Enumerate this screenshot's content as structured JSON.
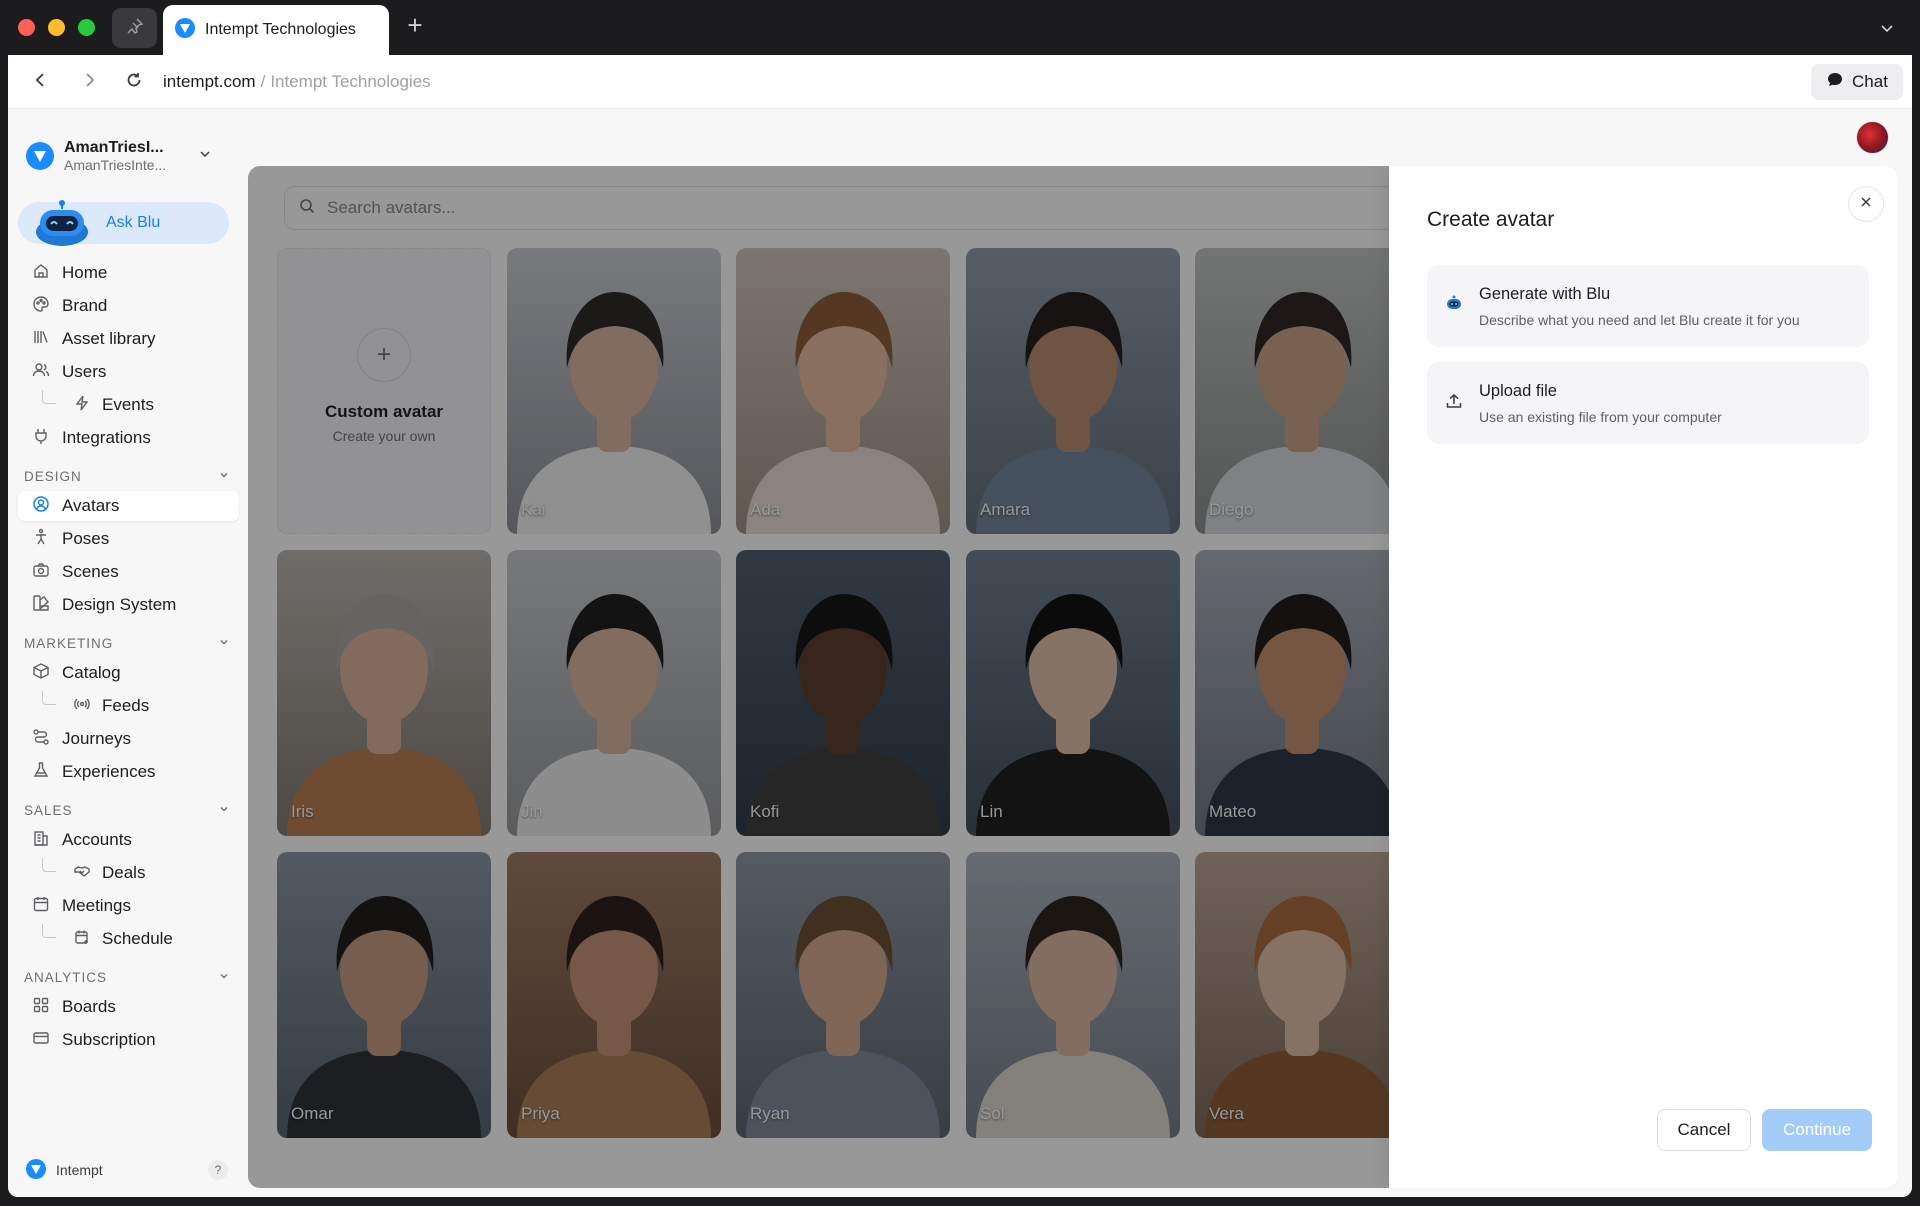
{
  "browser": {
    "tab_title": "Intempt Technologies",
    "url_domain": "intempt.com",
    "url_separator": "/",
    "url_title": "Intempt Technologies",
    "chat_label": "Chat"
  },
  "workspace": {
    "name": "AmanTriesI...",
    "subtitle": "AmanTriesInte..."
  },
  "ask_blu": "Ask Blu",
  "nav": {
    "home": "Home",
    "brand": "Brand",
    "asset_library": "Asset library",
    "users": "Users",
    "events": "Events",
    "integrations": "Integrations",
    "design_heading": "DESIGN",
    "avatars": "Avatars",
    "poses": "Poses",
    "scenes": "Scenes",
    "design_system": "Design System",
    "marketing_heading": "MARKETING",
    "catalog": "Catalog",
    "feeds": "Feeds",
    "journeys": "Journeys",
    "experiences": "Experiences",
    "sales_heading": "SALES",
    "accounts": "Accounts",
    "deals": "Deals",
    "meetings": "Meetings",
    "schedule": "Schedule",
    "analytics_heading": "ANALYTICS",
    "boards": "Boards",
    "subscription": "Subscription"
  },
  "footer": {
    "brand": "Intempt",
    "help": "?"
  },
  "search": {
    "placeholder": "Search avatars..."
  },
  "custom_avatar": {
    "title": "Custom avatar",
    "subtitle": "Create your own"
  },
  "avatars": [
    "Kai",
    "Ada",
    "Amara",
    "Diego",
    "Iris",
    "Jin",
    "Kofi",
    "Lin",
    "Mateo",
    "Omar",
    "Priya",
    "Ryan",
    "Sol",
    "Vera"
  ],
  "dialog": {
    "title": "Create avatar",
    "options": [
      {
        "title": "Generate with Blu",
        "description": "Describe what you need and let Blu create it for you"
      },
      {
        "title": "Upload file",
        "description": "Use an existing file from your computer"
      }
    ],
    "cancel": "Cancel",
    "continue": "Continue"
  }
}
